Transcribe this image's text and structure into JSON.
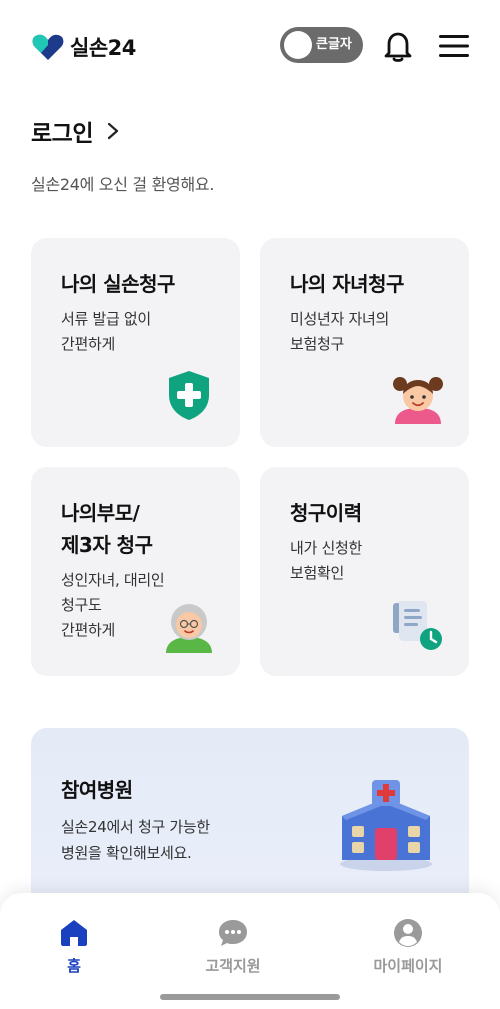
{
  "header": {
    "logo_text": "실손24",
    "large_text_toggle_label": "큰글자",
    "large_text_on": false,
    "icons": {
      "logo": "heart-logo-icon",
      "notifications": "bell-icon",
      "menu": "hamburger-menu-icon"
    }
  },
  "login": {
    "title": "로그인",
    "welcome": "실손24에 오신 걸 환영해요."
  },
  "cards": [
    {
      "title": "나의 실손청구",
      "desc_lines": [
        "서류 발급 없이",
        "간편하게"
      ],
      "icon": "shield-plus-icon"
    },
    {
      "title": "나의 자녀청구",
      "desc_lines": [
        "미성년자 자녀의",
        "보험청구"
      ],
      "icon": "child-girl-icon"
    },
    {
      "title_lines": [
        "나의부모/",
        "제3자 청구"
      ],
      "desc_lines": [
        "성인자녀, 대리인",
        "청구도",
        "간편하게"
      ],
      "icon": "grandparent-icon"
    },
    {
      "title": "청구이력",
      "desc_lines": [
        "내가 신청한",
        "보험확인"
      ],
      "icon": "document-clock-icon"
    }
  ],
  "hospital_banner": {
    "title": "참여병원",
    "desc_lines": [
      "실손24에서 청구 가능한",
      "병원을 확인해보세요."
    ],
    "icon": "hospital-building-icon"
  },
  "tabbar": {
    "tabs": [
      {
        "label": "홈",
        "icon": "home-icon",
        "active": true
      },
      {
        "label": "고객지원",
        "icon": "chat-bubble-icon",
        "active": false
      },
      {
        "label": "마이페이지",
        "icon": "user-profile-icon",
        "active": false
      }
    ]
  },
  "colors": {
    "accent": "#1a3fbf",
    "card_bg": "#f3f3f5",
    "shield_green": "#10a37f",
    "logo_teal": "#21c7b5",
    "logo_navy": "#1e3a8a",
    "banner_bg": "#e4ebf7"
  }
}
